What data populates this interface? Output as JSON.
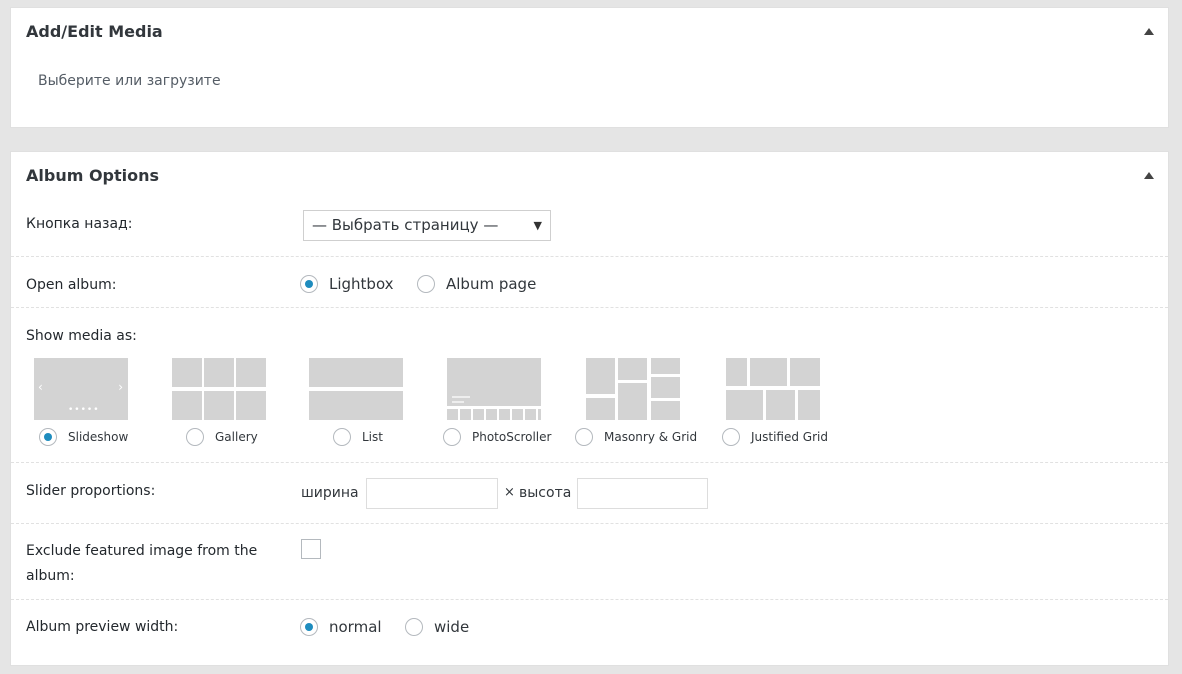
{
  "add_edit_media": {
    "title": "Add/Edit Media",
    "hint": "Выберите или загрузите"
  },
  "album_options": {
    "title": "Album Options",
    "back_button": {
      "label": "Кнопка назад:",
      "select_value": "— Выбрать страницу —"
    },
    "open_album": {
      "label": "Open album:",
      "options": [
        {
          "label": "Lightbox",
          "selected": true
        },
        {
          "label": "Album page",
          "selected": false
        }
      ]
    },
    "show_media": {
      "label": "Show media as:",
      "options": [
        {
          "label": "Slideshow",
          "selected": true
        },
        {
          "label": "Gallery",
          "selected": false
        },
        {
          "label": "List",
          "selected": false
        },
        {
          "label": "PhotoScroller",
          "selected": false
        },
        {
          "label": "Masonry & Grid",
          "selected": false
        },
        {
          "label": "Justified Grid",
          "selected": false
        }
      ]
    },
    "slider_proportions": {
      "label": "Slider proportions:",
      "width_label": "ширина",
      "times": "×",
      "height_label": "высота",
      "width_value": "",
      "height_value": ""
    },
    "exclude_featured": {
      "label_line1": "Exclude featured image from the",
      "label_line2": "album:",
      "checked": false
    },
    "preview_width": {
      "label": "Album preview width:",
      "options": [
        {
          "label": "normal",
          "selected": true
        },
        {
          "label": "wide",
          "selected": false
        }
      ]
    }
  },
  "colors": {
    "accent": "#1e8cbe",
    "thumb": "#d3d3d3",
    "background": "#e5e5e5"
  }
}
